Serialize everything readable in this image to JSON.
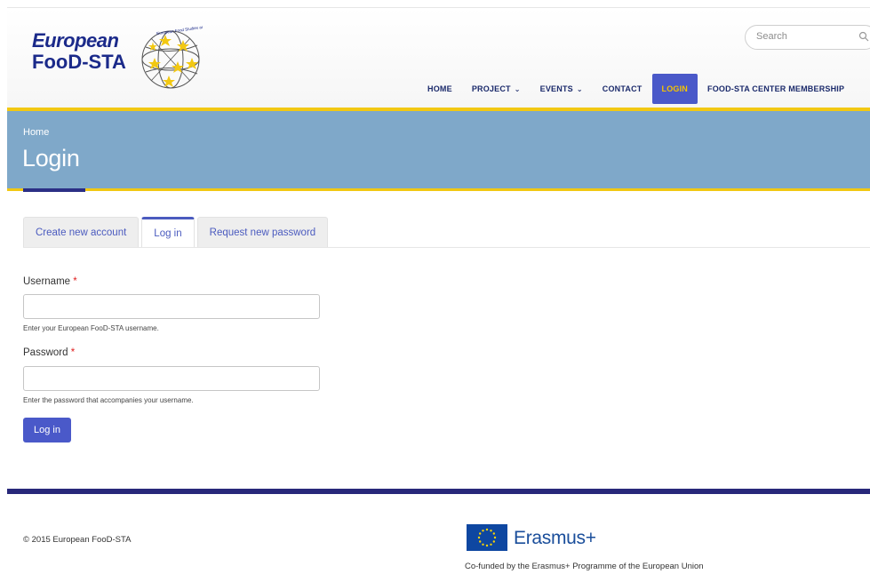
{
  "logo": {
    "line1": "European",
    "line2": "FooD-STA",
    "globe_caption": "European Food Studies and Training Alliance"
  },
  "search": {
    "placeholder": "Search"
  },
  "nav": [
    {
      "label": "HOME",
      "has_dropdown": false
    },
    {
      "label": "PROJECT",
      "has_dropdown": true
    },
    {
      "label": "EVENTS",
      "has_dropdown": true
    },
    {
      "label": "CONTACT",
      "has_dropdown": false
    },
    {
      "label": "LOGIN",
      "has_dropdown": false,
      "active": true
    },
    {
      "label": "FOOD-STA CENTER MEMBERSHIP",
      "has_dropdown": false
    }
  ],
  "breadcrumb": "Home",
  "page_title": "Login",
  "tabs": [
    {
      "label": "Create new account"
    },
    {
      "label": "Log in",
      "active": true
    },
    {
      "label": "Request new password"
    }
  ],
  "form": {
    "username_label": "Username",
    "username_value": "",
    "username_help": "Enter your European FooD-STA username.",
    "password_label": "Password",
    "password_value": "",
    "password_help": "Enter the password that accompanies your username.",
    "required_marker": "*",
    "submit_label": "Log in"
  },
  "footer": {
    "copyright": "© 2015 European FooD-STA",
    "erasmus_label": "Erasmus+",
    "cofunded_text": "Co-funded by the Erasmus+ Programme of the European Union"
  },
  "colors": {
    "brand_blue": "#1b2a8a",
    "accent_blue": "#4a59c9",
    "accent_yellow": "#f2c812",
    "band_blue": "#7fa8c9",
    "footer_rule": "#28287a"
  }
}
